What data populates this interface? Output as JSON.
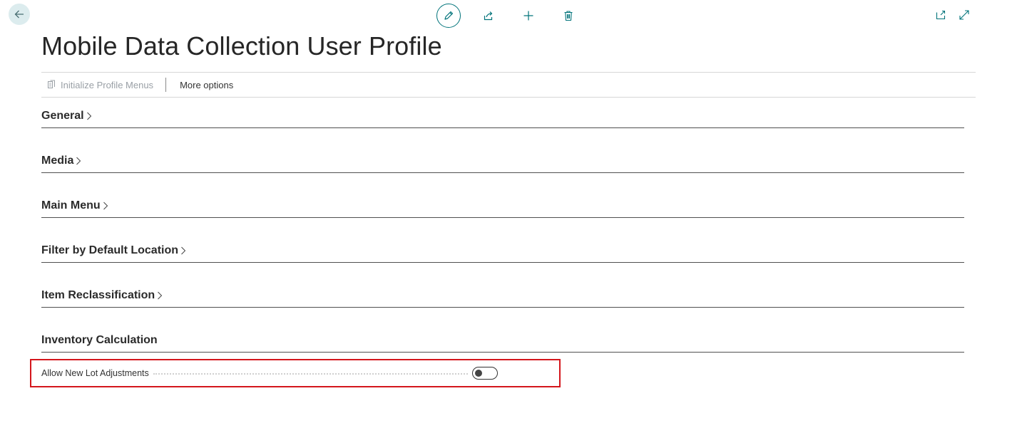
{
  "page": {
    "title": "Mobile Data Collection User Profile"
  },
  "top_actions": [
    {
      "name": "edit-button",
      "icon": "pencil-icon"
    },
    {
      "name": "share-button",
      "icon": "share-icon"
    },
    {
      "name": "new-button",
      "icon": "plus-icon"
    },
    {
      "name": "delete-button",
      "icon": "trash-icon"
    }
  ],
  "actionbar": {
    "initialize_label": "Initialize Profile Menus",
    "more_label": "More options"
  },
  "sections": [
    {
      "title": "General",
      "collapsed": true
    },
    {
      "title": "Media",
      "collapsed": true
    },
    {
      "title": "Main Menu",
      "collapsed": true
    },
    {
      "title": "Filter by Default Location",
      "collapsed": true
    },
    {
      "title": "Item Reclassification",
      "collapsed": true
    },
    {
      "title": "Inventory Calculation",
      "collapsed": false
    }
  ],
  "fields": {
    "allow_new_lot_adjustments": {
      "label": "Allow New Lot Adjustments",
      "value": false
    }
  },
  "colors": {
    "accent": "#00737a",
    "highlight": "#d4161c"
  }
}
